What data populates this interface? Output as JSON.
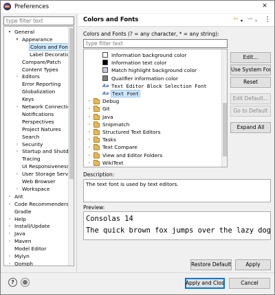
{
  "window": {
    "title": "Preferences"
  },
  "nav": {
    "filter_placeholder": "type filter text",
    "items": [
      {
        "label": "General",
        "twisty": "▾"
      },
      {
        "label": "Appearance",
        "twisty": "▾"
      },
      {
        "label": "Colors and Font",
        "twisty": ""
      },
      {
        "label": "Label Decoratio",
        "twisty": ""
      },
      {
        "label": "Compare/Patch",
        "twisty": ""
      },
      {
        "label": "Content Types",
        "twisty": ""
      },
      {
        "label": "Editors",
        "twisty": "›"
      },
      {
        "label": "Error Reporting",
        "twisty": ""
      },
      {
        "label": "Globalization",
        "twisty": ""
      },
      {
        "label": "Keys",
        "twisty": ""
      },
      {
        "label": "Network Connectio",
        "twisty": "›"
      },
      {
        "label": "Notifications",
        "twisty": ""
      },
      {
        "label": "Perspectives",
        "twisty": ""
      },
      {
        "label": "Project Natures",
        "twisty": ""
      },
      {
        "label": "Search",
        "twisty": ""
      },
      {
        "label": "Security",
        "twisty": "›"
      },
      {
        "label": "Startup and Shutdo",
        "twisty": "›"
      },
      {
        "label": "Tracing",
        "twisty": ""
      },
      {
        "label": "UI Responsiveness M",
        "twisty": ""
      },
      {
        "label": "User Storage Servic",
        "twisty": "›"
      },
      {
        "label": "Web Browser",
        "twisty": ""
      },
      {
        "label": "Workspace",
        "twisty": "›"
      },
      {
        "label": "Ant",
        "twisty": "›"
      },
      {
        "label": "Code Recommenders",
        "twisty": "›"
      },
      {
        "label": "Gradle",
        "twisty": ""
      },
      {
        "label": "Help",
        "twisty": "›"
      },
      {
        "label": "Install/Update",
        "twisty": "›"
      },
      {
        "label": "Java",
        "twisty": "›"
      },
      {
        "label": "Maven",
        "twisty": "›"
      },
      {
        "label": "Model Editor",
        "twisty": ""
      },
      {
        "label": "Mylyn",
        "twisty": "›"
      },
      {
        "label": "Oomph",
        "twisty": "›"
      }
    ]
  },
  "page": {
    "title": "Colors and Fonts",
    "intro": "Colors and Fonts (? = any character, * = any string):",
    "filter_placeholder": "type filter text",
    "tree": [
      {
        "label": "Information background color",
        "kind": "swatch",
        "color": "#ffffff",
        "twisty": ""
      },
      {
        "label": "Information text color",
        "kind": "swatch",
        "color": "#000000",
        "twisty": ""
      },
      {
        "label": "Match highlight background color",
        "kind": "swatch",
        "color": "#c8c8e0",
        "twisty": ""
      },
      {
        "label": "Qualifier information color",
        "kind": "swatch",
        "color": "#808080",
        "twisty": ""
      },
      {
        "label": "Text Editor Block Selection Font",
        "kind": "font",
        "icon": "Aa",
        "twisty": ""
      },
      {
        "label": "Text Font",
        "kind": "font",
        "icon": "Aa",
        "twisty": ""
      },
      {
        "label": "Debug",
        "kind": "folder",
        "twisty": "›"
      },
      {
        "label": "Git",
        "kind": "folder",
        "twisty": "›"
      },
      {
        "label": "Java",
        "kind": "folder",
        "twisty": "›"
      },
      {
        "label": "Snipmatch",
        "kind": "folder",
        "twisty": "›"
      },
      {
        "label": "Structured Text Editors",
        "kind": "folder",
        "twisty": "›"
      },
      {
        "label": "Tasks",
        "kind": "folder",
        "twisty": "›"
      },
      {
        "label": "Text Compare",
        "kind": "folder",
        "twisty": "›"
      },
      {
        "label": "View and Editor Folders",
        "kind": "folder",
        "twisty": "›"
      },
      {
        "label": "WikiText",
        "kind": "folder",
        "twisty": "›"
      }
    ],
    "buttons": {
      "edit": "Edit...",
      "use_system_font": "Use System Font",
      "reset": "Reset",
      "edit_default": "Edit Default...",
      "go_to_default": "Go to Default",
      "expand_all": "Expand All"
    },
    "description_label": "Description:",
    "description_text": "The text font is used by text editors.",
    "preview_label": "Preview:",
    "preview_lines": [
      "Consolas 14",
      "The quick brown fox jumps over the lazy dog."
    ],
    "restore_defaults": "Restore Defaults",
    "apply": "Apply"
  },
  "footer": {
    "apply_close": "Apply and Close",
    "cancel": "Cancel",
    "help_icon": "?"
  }
}
